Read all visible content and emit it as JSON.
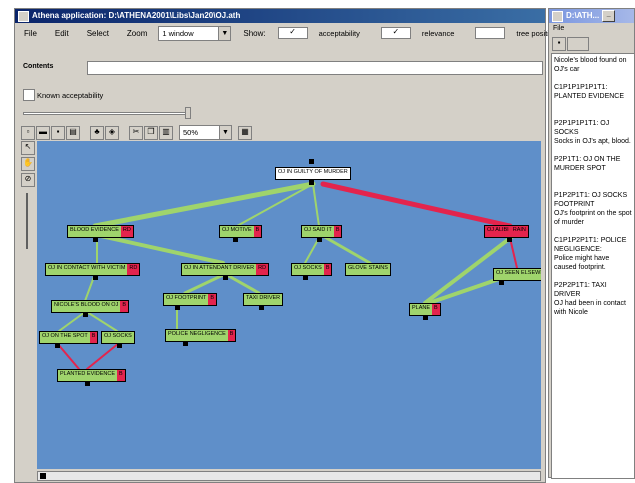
{
  "main_window": {
    "title": "Athena application: D:\\ATHENA2001\\Libs\\Jan20\\OJ.ath",
    "menu": [
      "File",
      "Edit",
      "Select",
      "Zoom"
    ],
    "view_select": "1 window",
    "show_label": "Show:",
    "checks": [
      {
        "label": "acceptability",
        "checked": true
      },
      {
        "label": "relevance",
        "checked": true
      },
      {
        "label": "tree position",
        "checked": false
      }
    ],
    "contents_label": "Contents",
    "contents_value": "",
    "known_acceptability_label": "Known acceptability",
    "known_acceptability_checked": false,
    "zoom_value": "50%"
  },
  "graph": {
    "nodes": [
      {
        "id": "root",
        "label": "OJ IN GUILTY OF MURDER",
        "color": "#ffffff",
        "red": "",
        "style": "root"
      },
      {
        "id": "n1",
        "label": "BLOOD EVIDENCE",
        "red": "RD"
      },
      {
        "id": "n2",
        "label": "OJ MOTIVE",
        "red": "B"
      },
      {
        "id": "n3",
        "label": "OJ SAID IT",
        "red": "B"
      },
      {
        "id": "n4",
        "label": "OJ ALIBI",
        "red": "RAIN"
      },
      {
        "id": "n5",
        "label": "OJ IN CONTACT WITH VICTIM",
        "red": "RD"
      },
      {
        "id": "n6",
        "label": "OJ IN ATTENDANT DRIVER",
        "red": "RD"
      },
      {
        "id": "n7",
        "label": "OJ SOCKS",
        "red": "B"
      },
      {
        "id": "n8",
        "label": "GLOVE STAINS",
        "red": ""
      },
      {
        "id": "n9",
        "label": "NICOLE'S BLOOD ON OJ",
        "red": "B"
      },
      {
        "id": "n10",
        "label": "OJ FOOTPRINT",
        "red": "B"
      },
      {
        "id": "n11",
        "label": "TAXI DRIVER",
        "red": ""
      },
      {
        "id": "n12",
        "label": "OJ ON THE SPOT",
        "red": "B"
      },
      {
        "id": "n13",
        "label": "OJ SOCKS",
        "red": ""
      },
      {
        "id": "n14",
        "label": "POLICE NEGLIGENCE",
        "red": "B"
      },
      {
        "id": "n15",
        "label": "PLANTED EVIDENCE",
        "red": "B"
      },
      {
        "id": "n16",
        "label": "OJ SEEN ELSEWHERE",
        "red": "B"
      },
      {
        "id": "n17",
        "label": "PLANE",
        "red": "B"
      }
    ]
  },
  "side_window": {
    "title": "D:\\ATH...",
    "menu": "File",
    "text": "Nicole's blood found on OJ's car\n\nC1P1P1P1P1T1: PLANTED EVIDENCE\n\n\nP2P1P1P1T1: OJ SOCKS\nSocks in OJ's apt, blood.\n\nP2P1T1: OJ ON THE MURDER SPOT\n\n\nP1P2P1T1: OJ SOCKS FOOTPRINT\nOJ's footprint on the spot of murder\n\nC1P1P2P1T1: POLICE NEGLIGENCE:\nPolice might have caused footprint.\n\nP2P2P1T1: TAXI DRIVER\nOJ had been in contact with Nicole"
  },
  "colors": {
    "canvas": "#5f8fc9",
    "support": "#9fd46c",
    "attack": "#e3244d",
    "title": "#0a246a"
  }
}
